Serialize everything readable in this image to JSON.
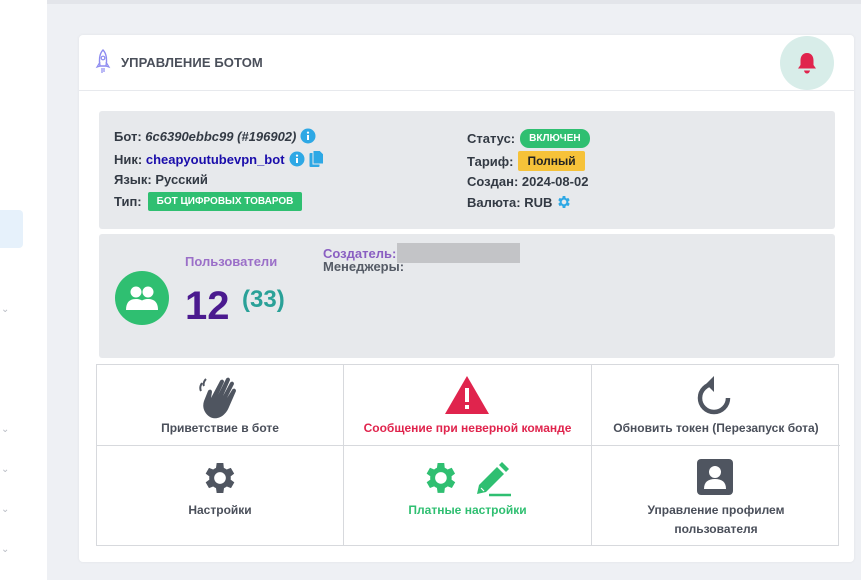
{
  "header": {
    "title": "УПРАВЛЕНИЕ БОТОМ"
  },
  "bot": {
    "bot_label": "Бот:",
    "bot_id": "6c6390ebbc99 (#196902)",
    "nick_label": "Ник:",
    "nick_value": "cheapyoutubevpn_bot",
    "lang_label": "Язык:",
    "lang_value": "Русский",
    "type_label": "Тип:",
    "type_value": "БОТ ЦИФРОВЫХ ТОВАРОВ",
    "status_label": "Статус:",
    "status_value": "ВКЛЮЧЕН",
    "tariff_label": "Тариф:",
    "tariff_value": "Полный",
    "created_label": "Создан:",
    "created_value": "2024-08-02",
    "currency_label": "Валюта:",
    "currency_value": "RUB"
  },
  "users": {
    "label": "Пользователи",
    "count": "12",
    "total": "(33)",
    "creator_label": "Создатель:",
    "managers_label": "Менеджеры:"
  },
  "actions": [
    {
      "label": "Приветствие в боте",
      "color": "#4a4f5a"
    },
    {
      "label": "Сообщение при неверной команде",
      "color": "#e0244d"
    },
    {
      "label": "Обновить токен (Перезапуск бота)",
      "color": "#4a4f5a"
    },
    {
      "label": "Настройки",
      "color": "#4a4f5a"
    },
    {
      "label": "Платные настройки",
      "color": "#2fbf71"
    },
    {
      "label_line1": "Управление профилем",
      "label_line2": "пользователя",
      "color": "#4a4f5a"
    }
  ],
  "colors": {
    "accent_green": "#2fbf71",
    "danger_red": "#e0244d",
    "icon_gray": "#4f5560",
    "users_purple": "#4b1a8f",
    "teal": "#2aa198",
    "info_blue": "#2ea8e5"
  },
  "icons": {
    "header": "rocket-icon",
    "notification": "bell-icon",
    "users": "users-icon",
    "greeting": "waving-hand-icon",
    "wrong_command": "warning-triangle-icon",
    "refresh_token": "refresh-icon",
    "settings": "gear-icon",
    "paid_settings": "gear-pencil-icon",
    "profile": "user-profile-icon"
  }
}
